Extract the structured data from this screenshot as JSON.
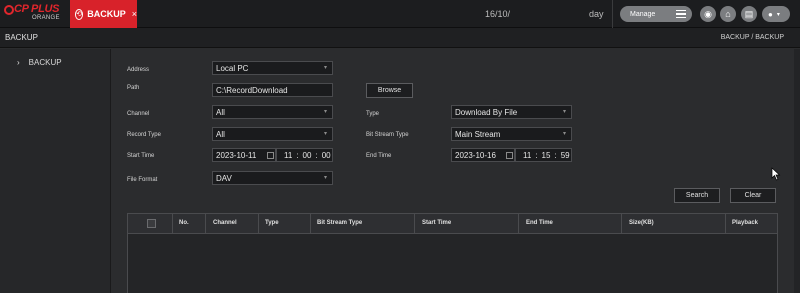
{
  "header": {
    "logo_brand": "CP PLUS",
    "logo_sub": "ORANGE",
    "tab_label": "BACKUP",
    "date": "16/10/",
    "day": "day",
    "manage_label": "Manage"
  },
  "title": {
    "page_title": "BACKUP",
    "breadcrumb": "BACKUP / BACKUP"
  },
  "sidebar": {
    "items": [
      {
        "label": "BACKUP"
      }
    ]
  },
  "form": {
    "address_label": "Address",
    "address_value": "Local PC",
    "path_label": "Path",
    "path_value": "C:\\RecordDownload",
    "browse_label": "Browse",
    "channel_label": "Channel",
    "channel_value": "All",
    "type_label": "Type",
    "type_value": "Download By File",
    "record_type_label": "Record Type",
    "record_type_value": "All",
    "bit_stream_type_label": "Bit Stream Type",
    "bit_stream_type_value": "Main Stream",
    "start_time_label": "Start Time",
    "start_date": "2023-10-11",
    "start_hh": "11",
    "start_mm": "00",
    "start_ss": "00",
    "end_time_label": "End Time",
    "end_date": "2023-10-16",
    "end_hh": "11",
    "end_mm": "15",
    "end_ss": "59",
    "file_format_label": "File Format",
    "file_format_value": "DAV",
    "search_label": "Search",
    "clear_label": "Clear"
  },
  "table": {
    "columns": [
      "No.",
      "Channel",
      "Type",
      "Bit Stream Type",
      "Start Time",
      "End Time",
      "Size(KB)",
      "Playback"
    ]
  },
  "colors": {
    "accent": "#d8222a",
    "background": "#2b2c2e",
    "topbar": "#1c1d1f"
  }
}
